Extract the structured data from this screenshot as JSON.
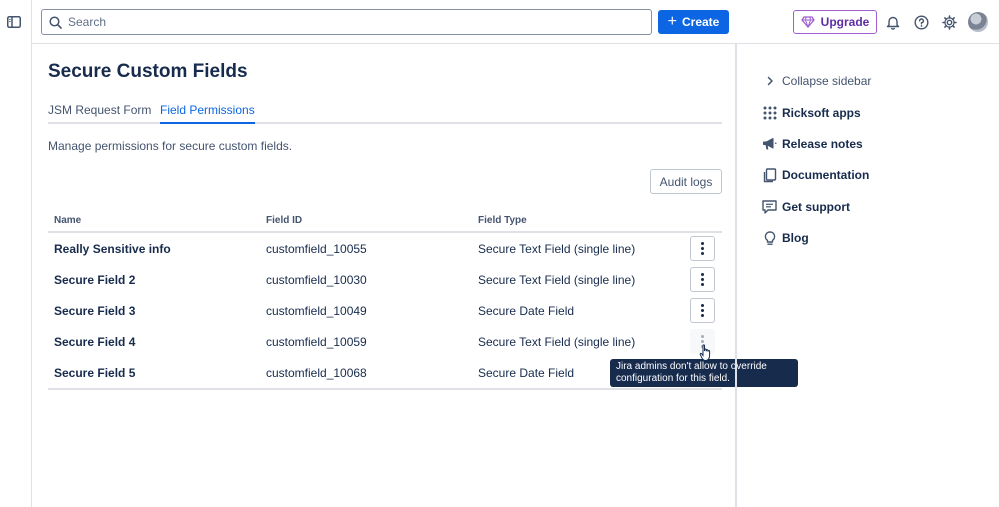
{
  "search": {
    "placeholder": "Search"
  },
  "topbar": {
    "create_label": "Create",
    "upgrade_label": "Upgrade"
  },
  "page": {
    "title": "Secure Custom Fields",
    "tabs": [
      {
        "label": "JSM Request Form",
        "selected": false
      },
      {
        "label": "Field Permissions",
        "selected": true
      }
    ],
    "description": "Manage permissions for secure custom fields.",
    "audit_logs_label": "Audit logs"
  },
  "table": {
    "headers": [
      "Name",
      "Field ID",
      "Field Type"
    ],
    "rows": [
      {
        "name": "Really Sensitive info",
        "field_id": "customfield_10055",
        "field_type": "Secure Text Field (single line)",
        "actions_enabled": true
      },
      {
        "name": "Secure Field 2",
        "field_id": "customfield_10030",
        "field_type": "Secure Text Field (single line)",
        "actions_enabled": true
      },
      {
        "name": "Secure Field 3",
        "field_id": "customfield_10049",
        "field_type": "Secure Date Field",
        "actions_enabled": true
      },
      {
        "name": "Secure Field 4",
        "field_id": "customfield_10059",
        "field_type": "Secure Text Field (single line)",
        "actions_enabled": false
      },
      {
        "name": "Secure Field 5",
        "field_id": "customfield_10068",
        "field_type": "Secure Date Field",
        "actions_enabled": true
      }
    ]
  },
  "tooltip": {
    "text": "Jira admins don't allow to override configuration for this field."
  },
  "sidebar": {
    "collapse_label": "Collapse sidebar",
    "items": [
      {
        "label": "Ricksoft apps",
        "icon": "apps-grid-icon"
      },
      {
        "label": "Release notes",
        "icon": "megaphone-icon"
      },
      {
        "label": "Documentation",
        "icon": "documents-icon"
      },
      {
        "label": "Get support",
        "icon": "support-chat-icon"
      },
      {
        "label": "Blog",
        "icon": "lightbulb-icon"
      }
    ]
  },
  "colors": {
    "primary": "#0c66e4",
    "upgrade": "#5e2ca5",
    "text": "#172b4d",
    "subtle": "#44546f",
    "tooltip_bg": "#172b4d"
  }
}
